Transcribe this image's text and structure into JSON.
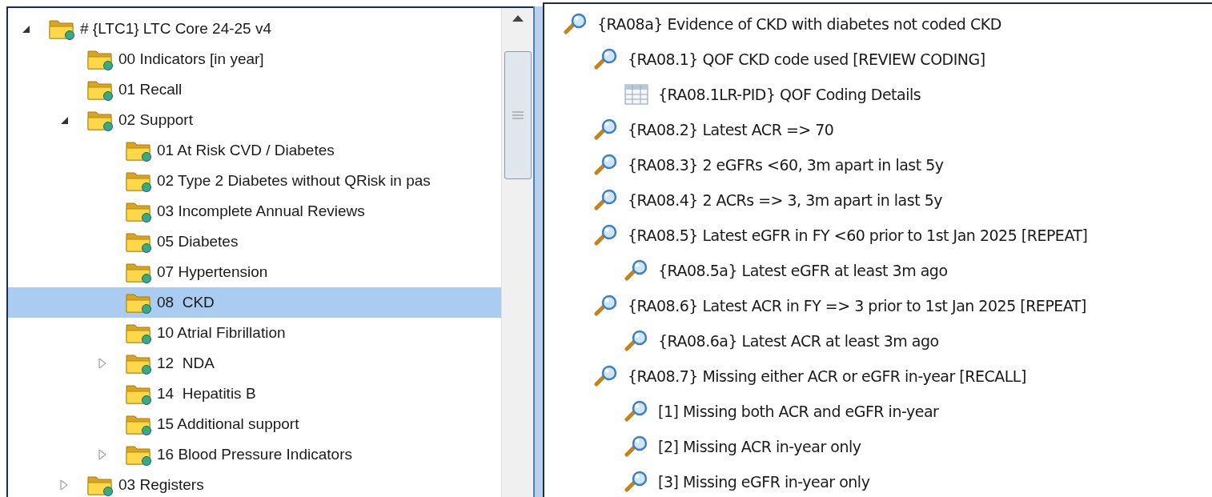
{
  "tree": [
    {
      "label": "# {LTC1} LTC Core 24-25 v4",
      "expanded": true,
      "selected": false,
      "children": [
        {
          "label": "00 Indicators [in year]",
          "selected": false
        },
        {
          "label": "01 Recall",
          "selected": false
        },
        {
          "label": "02 Support",
          "expanded": true,
          "selected": false,
          "children": [
            {
              "label": "01 At Risk CVD / Diabetes",
              "selected": false
            },
            {
              "label": "02 Type 2 Diabetes without QRisk in pas",
              "selected": false
            },
            {
              "label": "03 Incomplete Annual Reviews",
              "selected": false
            },
            {
              "label": "05 Diabetes",
              "selected": false
            },
            {
              "label": "07 Hypertension",
              "selected": false
            },
            {
              "label": "08  CKD",
              "selected": true
            },
            {
              "label": "10 Atrial Fibrillation",
              "selected": false
            },
            {
              "label": "12  NDA",
              "expanded": false,
              "selected": false
            },
            {
              "label": "14  Hepatitis B",
              "selected": false
            },
            {
              "label": "15 Additional support",
              "selected": false
            },
            {
              "label": "16 Blood Pressure Indicators",
              "expanded": false,
              "selected": false
            }
          ]
        },
        {
          "label": "03 Registers",
          "expanded": false,
          "selected": false
        }
      ]
    }
  ],
  "details": [
    {
      "kind": "search",
      "label": "{RA08a} Evidence of CKD with diabetes not coded CKD",
      "children": [
        {
          "kind": "search",
          "label": "{RA08.1} QOF CKD code used [REVIEW CODING]",
          "children": [
            {
              "kind": "report",
              "label": "{RA08.1LR-PID} QOF Coding Details"
            }
          ]
        },
        {
          "kind": "search",
          "label": "{RA08.2} Latest ACR => 70"
        },
        {
          "kind": "search",
          "label": "{RA08.3} 2 eGFRs <60, 3m apart in last 5y"
        },
        {
          "kind": "search",
          "label": "{RA08.4} 2 ACRs => 3, 3m apart in last 5y"
        },
        {
          "kind": "search",
          "label": "{RA08.5} Latest eGFR in FY <60 prior to 1st Jan 2025 [REPEAT]",
          "children": [
            {
              "kind": "search",
              "label": "{RA08.5a} Latest eGFR at least 3m ago"
            }
          ]
        },
        {
          "kind": "search",
          "label": "{RA08.6} Latest ACR in FY => 3 prior to 1st Jan 2025 [REPEAT]",
          "children": [
            {
              "kind": "search",
              "label": "{RA08.6a} Latest ACR at least 3m ago"
            }
          ]
        },
        {
          "kind": "search",
          "label": "{RA08.7} Missing either ACR or eGFR in-year [RECALL]",
          "children": [
            {
              "kind": "search",
              "label": "[1] Missing both ACR and eGFR in-year"
            },
            {
              "kind": "search",
              "label": "[2] Missing ACR in-year only"
            },
            {
              "kind": "search",
              "label": "[3] Missing eGFR in-year only"
            }
          ]
        }
      ]
    }
  ]
}
